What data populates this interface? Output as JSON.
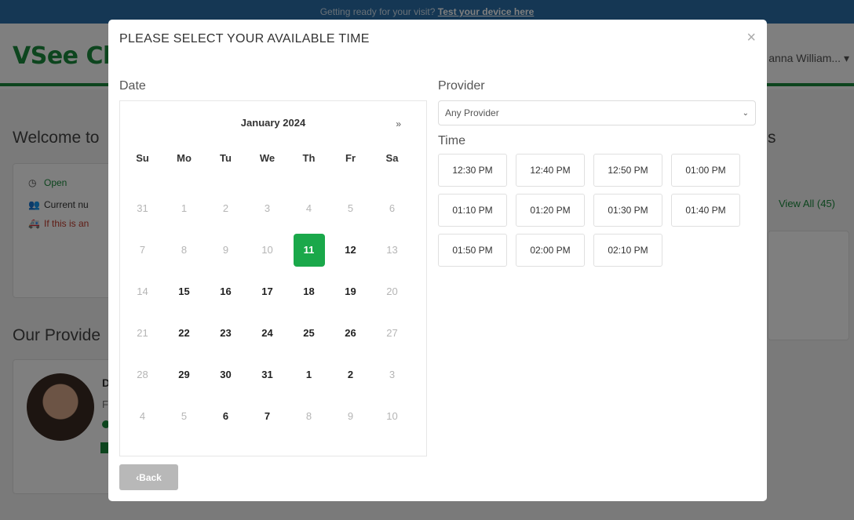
{
  "banner": {
    "text": "Getting ready for your visit?",
    "link": "Test your device here"
  },
  "header": {
    "logo": "VSee Cl",
    "user": "anna William...",
    "user_caret": "▾"
  },
  "background": {
    "welcome": "Welcome to",
    "welcome_right": "s",
    "status_open": "Open",
    "status_current": "Current nu",
    "status_emergency": "If this is an",
    "view_all": "View All (45)",
    "providers_title": "Our Provide",
    "provider_initial": "D",
    "provider_sub": "F"
  },
  "modal": {
    "title": "PLEASE SELECT YOUR AVAILABLE TIME",
    "close": "×",
    "date_label": "Date",
    "provider_label": "Provider",
    "time_label": "Time",
    "back_label": "‹Back"
  },
  "calendar": {
    "month": "January 2024",
    "next": "»",
    "dow": [
      "Su",
      "Mo",
      "Tu",
      "We",
      "Th",
      "Fr",
      "Sa"
    ],
    "days": [
      {
        "d": "31",
        "s": "muted"
      },
      {
        "d": "1",
        "s": "muted"
      },
      {
        "d": "2",
        "s": "muted"
      },
      {
        "d": "3",
        "s": "muted"
      },
      {
        "d": "4",
        "s": "muted"
      },
      {
        "d": "5",
        "s": "muted"
      },
      {
        "d": "6",
        "s": "muted"
      },
      {
        "d": "7",
        "s": "muted"
      },
      {
        "d": "8",
        "s": "muted"
      },
      {
        "d": "9",
        "s": "muted"
      },
      {
        "d": "10",
        "s": "muted"
      },
      {
        "d": "11",
        "s": "selected"
      },
      {
        "d": "12",
        "s": "avail"
      },
      {
        "d": "13",
        "s": "muted"
      },
      {
        "d": "14",
        "s": "muted"
      },
      {
        "d": "15",
        "s": "avail"
      },
      {
        "d": "16",
        "s": "avail"
      },
      {
        "d": "17",
        "s": "avail"
      },
      {
        "d": "18",
        "s": "avail"
      },
      {
        "d": "19",
        "s": "avail"
      },
      {
        "d": "20",
        "s": "muted"
      },
      {
        "d": "21",
        "s": "muted"
      },
      {
        "d": "22",
        "s": "avail"
      },
      {
        "d": "23",
        "s": "avail"
      },
      {
        "d": "24",
        "s": "avail"
      },
      {
        "d": "25",
        "s": "avail"
      },
      {
        "d": "26",
        "s": "avail"
      },
      {
        "d": "27",
        "s": "muted"
      },
      {
        "d": "28",
        "s": "muted"
      },
      {
        "d": "29",
        "s": "avail"
      },
      {
        "d": "30",
        "s": "avail"
      },
      {
        "d": "31",
        "s": "avail"
      },
      {
        "d": "1",
        "s": "avail"
      },
      {
        "d": "2",
        "s": "avail"
      },
      {
        "d": "3",
        "s": "muted"
      },
      {
        "d": "4",
        "s": "muted"
      },
      {
        "d": "5",
        "s": "muted"
      },
      {
        "d": "6",
        "s": "avail"
      },
      {
        "d": "7",
        "s": "avail"
      },
      {
        "d": "8",
        "s": "muted"
      },
      {
        "d": "9",
        "s": "muted"
      },
      {
        "d": "10",
        "s": "muted"
      }
    ]
  },
  "provider_select": {
    "value": "Any Provider",
    "chevron": "⌄"
  },
  "times": [
    "12:30 PM",
    "12:40 PM",
    "12:50 PM",
    "01:00 PM",
    "01:10 PM",
    "01:20 PM",
    "01:30 PM",
    "01:40 PM",
    "01:50 PM",
    "02:00 PM",
    "02:10 PM"
  ],
  "colors": {
    "brand_green": "#1a8a3c",
    "selected_green": "#1aa84a",
    "banner_blue": "#2a6ea8",
    "back_gray": "#b8b8b8"
  }
}
